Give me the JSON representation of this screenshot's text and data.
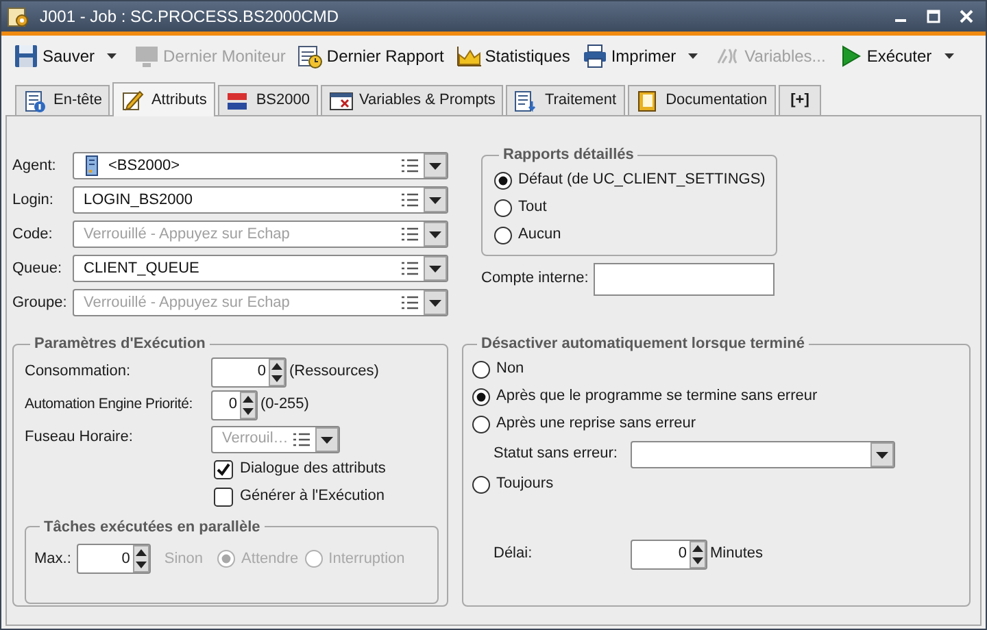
{
  "window": {
    "title": "J001 - Job : SC.PROCESS.BS2000CMD"
  },
  "toolbar": [
    {
      "label": "Sauver",
      "disabled": false,
      "dropdown": true
    },
    {
      "label": "Dernier Moniteur",
      "disabled": true,
      "dropdown": false
    },
    {
      "label": "Dernier Rapport",
      "disabled": false,
      "dropdown": false
    },
    {
      "label": "Statistiques",
      "disabled": false,
      "dropdown": false
    },
    {
      "label": "Imprimer",
      "disabled": false,
      "dropdown": true
    },
    {
      "label": "Variables...",
      "disabled": true,
      "dropdown": false
    },
    {
      "label": "Exécuter",
      "disabled": false,
      "dropdown": true
    }
  ],
  "tabs": [
    {
      "label": "En-tête",
      "selected": false
    },
    {
      "label": "Attributs",
      "selected": true
    },
    {
      "label": "BS2000",
      "selected": false
    },
    {
      "label": "Variables & Prompts",
      "selected": false
    },
    {
      "label": "Traitement",
      "selected": false
    },
    {
      "label": "Documentation",
      "selected": false
    },
    {
      "label": "[+]",
      "selected": false
    }
  ],
  "fields": [
    {
      "label": "Agent:",
      "value": "<BS2000>",
      "kind": "agent"
    },
    {
      "label": "Login:",
      "value": "LOGIN_BS2000",
      "kind": "text"
    },
    {
      "label": "Code:",
      "placeholder": "Verrouillé - Appuyez sur Echap",
      "kind": "text"
    },
    {
      "label": "Queue:",
      "value": "CLIENT_QUEUE",
      "kind": "text"
    },
    {
      "label": "Groupe:",
      "placeholder": "Verrouillé - Appuyez sur Echap",
      "kind": "text"
    }
  ],
  "detailed_reports": {
    "title": "Rapports détaillés",
    "options": [
      {
        "label": "Défaut (de UC_CLIENT_SETTINGS)",
        "selected": true
      },
      {
        "label": "Tout",
        "selected": false
      },
      {
        "label": "Aucun",
        "selected": false
      }
    ]
  },
  "internal_account": {
    "label": "Compte interne:"
  },
  "execution": {
    "title": "Paramètres d'Exécution",
    "consumption": {
      "label": "Consommation:",
      "value": "0",
      "unit": "(Ressources)"
    },
    "priority": {
      "label": "Automation Engine Priorité:",
      "value": "0",
      "unit": "(0-255)"
    },
    "timezone": {
      "label": "Fuseau Horaire:",
      "placeholder": "Verrouil…"
    },
    "checkboxes": [
      {
        "label": "Dialogue des attributs",
        "checked": true
      },
      {
        "label": "Générer à l'Exécution",
        "checked": false
      }
    ],
    "parallel": {
      "title": "Tâches exécutées en parallèle",
      "max_label": "Max.:",
      "max_value": "0",
      "else_label": "Sinon",
      "disabled": true,
      "options": [
        {
          "label": "Attendre",
          "selected": true
        },
        {
          "label": "Interruption",
          "selected": false
        }
      ]
    }
  },
  "deactivate": {
    "title": "Désactiver automatiquement lorsque terminé",
    "options": [
      {
        "label": "Non",
        "selected": false
      },
      {
        "label": "Après que le programme se termine sans erreur",
        "selected": true
      },
      {
        "label": "Après une reprise sans erreur",
        "selected": false,
        "sub_field": {
          "label": "Statut sans erreur:"
        }
      },
      {
        "label": "Toujours",
        "selected": false
      }
    ],
    "delay": {
      "label": "Délai:",
      "value": "0",
      "unit": "Minutes"
    }
  }
}
